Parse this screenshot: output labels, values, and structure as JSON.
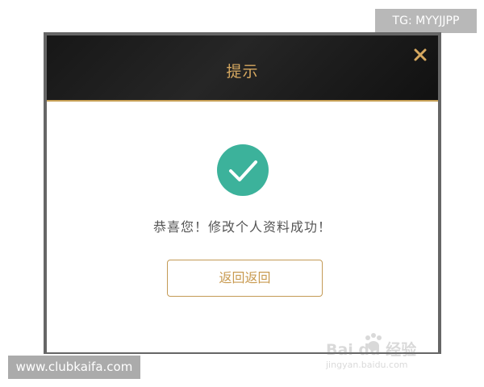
{
  "watermarks": {
    "top_tag": "TG: MYYJJPP",
    "bottom_url": "www.clubkaifa.com",
    "baidu_text": "Bai du 经验",
    "baidu_sub": "jingyan.baidu.com"
  },
  "dialog": {
    "title": "提示",
    "close_icon": "close-icon",
    "success_icon": "check-circle-icon",
    "message": "恭喜您！修改个人资料成功！",
    "back_button_label": "返回返回"
  },
  "colors": {
    "header_bg": "#1c1c1c",
    "title_gold": "#d6a860",
    "accent_gold": "#c39a55",
    "success_green": "#3cb29b",
    "border_gray": "#666666"
  }
}
